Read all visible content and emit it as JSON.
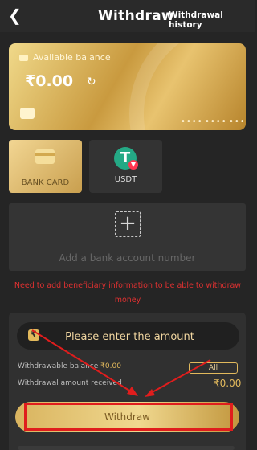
{
  "header": {
    "title": "Withdraw",
    "history_label": "Withdrawal history"
  },
  "balance_card": {
    "label": "Available balance",
    "amount": "₹0.00",
    "masked_digits": [
      "••••",
      "••••",
      "••••"
    ]
  },
  "methods": [
    {
      "label": "BANK CARD",
      "selected": true,
      "icon": "bank-card-icon"
    },
    {
      "label": "USDT",
      "selected": false,
      "icon": "usdt-tether-icon"
    }
  ],
  "bank_account": {
    "add_text": "Add a bank account number"
  },
  "warning": "Need to add beneficiary information to be able to withdraw money",
  "withdraw_form": {
    "amount_placeholder": "Please enter the amount",
    "withdrawable_label": "Withdrawable balance",
    "withdrawable_value": "₹0.00",
    "all_label": "All",
    "received_label": "Withdrawal amount received",
    "received_value": "₹0.00",
    "submit_label": "Withdraw"
  },
  "colors": {
    "gold": "#e2b95c",
    "warning_red": "#e03131",
    "background": "#252525"
  }
}
